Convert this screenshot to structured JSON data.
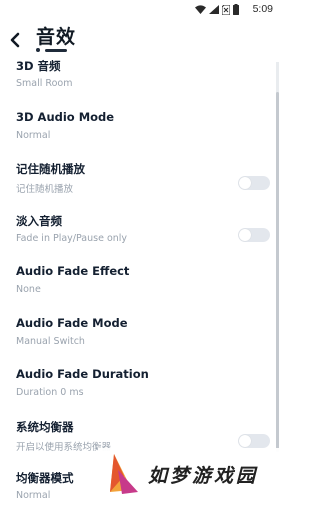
{
  "status_bar": {
    "time": "5:09"
  },
  "header": {
    "title": "音效"
  },
  "settings": [
    {
      "title": "3D 音频",
      "subtitle": "Small Room",
      "has_toggle": false
    },
    {
      "title": "3D Audio Mode",
      "subtitle": "Normal",
      "has_toggle": false
    },
    {
      "title": "记住随机播放",
      "subtitle": "记住随机播放",
      "has_toggle": true,
      "toggle_on": false
    },
    {
      "title": "淡入音频",
      "subtitle": "Fade in Play/Pause only",
      "has_toggle": true,
      "toggle_on": false
    },
    {
      "title": "Audio Fade Effect",
      "subtitle": "None",
      "has_toggle": false
    },
    {
      "title": "Audio Fade Mode",
      "subtitle": "Manual Switch",
      "has_toggle": false
    },
    {
      "title": "Audio Fade Duration",
      "subtitle": "Duration 0 ms",
      "has_toggle": false
    },
    {
      "title": "系统均衡器",
      "subtitle": "开启以使用系统均衡器",
      "has_toggle": true,
      "toggle_on": false
    },
    {
      "title": "均衡器模式",
      "subtitle": "Normal",
      "has_toggle": false
    }
  ],
  "watermark": {
    "text": "如梦游戏园"
  },
  "colors": {
    "toggle_off": "#e3e7ed",
    "title": "#142031",
    "subtitle": "#9aa3ae"
  }
}
